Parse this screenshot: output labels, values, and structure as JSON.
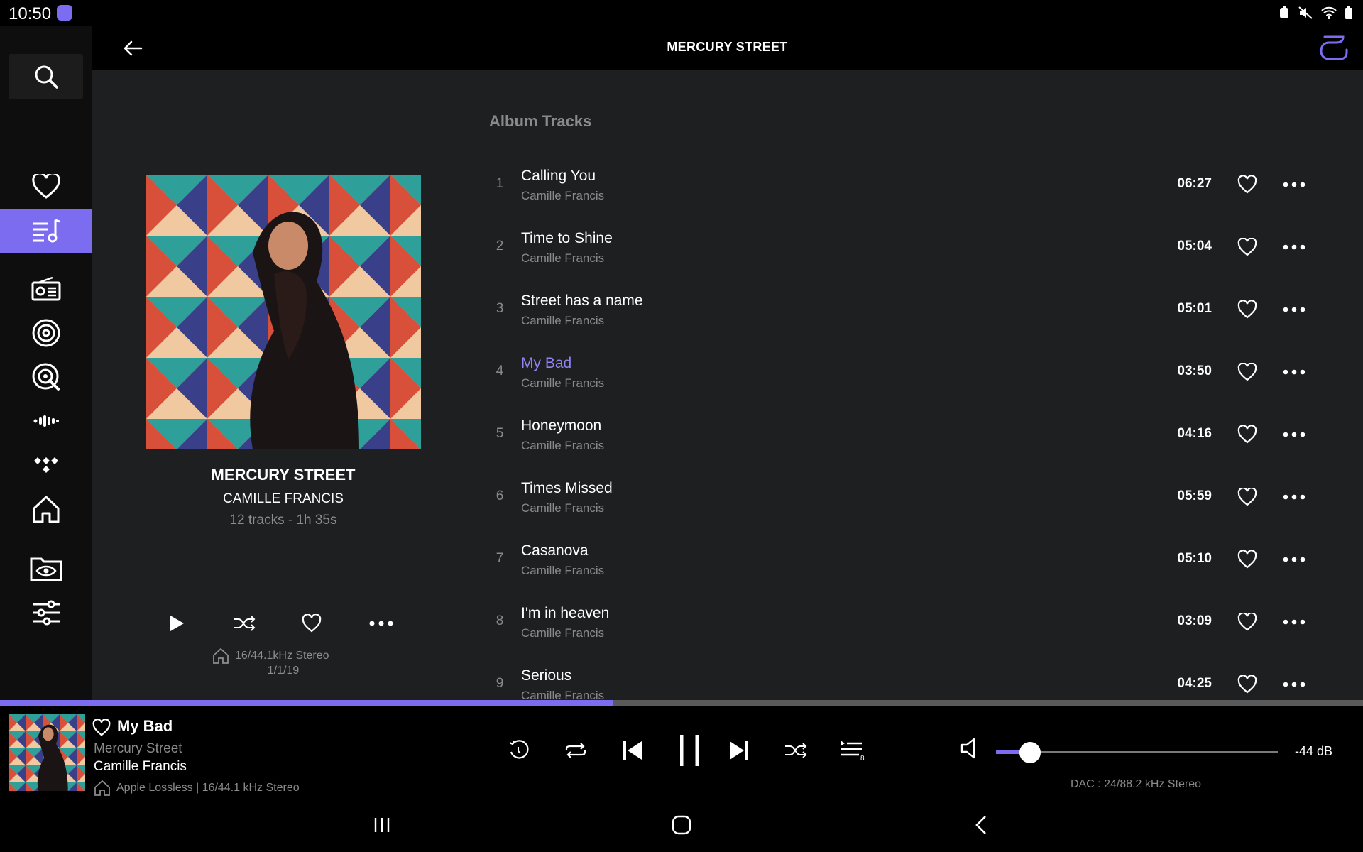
{
  "status": {
    "time": "10:50"
  },
  "header": {
    "title": "MERCURY STREET"
  },
  "sidebar": {
    "items": [
      {
        "name": "search-icon"
      },
      {
        "name": "heart-icon"
      },
      {
        "name": "library-icon",
        "active": true
      },
      {
        "name": "radio-icon"
      },
      {
        "name": "live-radio-icon"
      },
      {
        "name": "qobuz-icon"
      },
      {
        "name": "podcast-icon"
      },
      {
        "name": "tidal-icon"
      },
      {
        "name": "home-icon"
      },
      {
        "name": "folder-eye-icon"
      },
      {
        "name": "settings-sliders-icon"
      }
    ]
  },
  "album": {
    "title": "MERCURY STREET",
    "artist": "CAMILLE FRANCIS",
    "meta": "12 tracks - 1h 35s",
    "format": "16/44.1kHz Stereo",
    "date": "1/1/19"
  },
  "tracks_heading": "Album Tracks",
  "tracks": [
    {
      "num": "1",
      "title": "Calling You",
      "artist": "Camille Francis",
      "duration": "06:27",
      "playing": false
    },
    {
      "num": "2",
      "title": "Time to Shine",
      "artist": "Camille Francis",
      "duration": "05:04",
      "playing": false
    },
    {
      "num": "3",
      "title": "Street has a name",
      "artist": "Camille Francis",
      "duration": "05:01",
      "playing": false
    },
    {
      "num": "4",
      "title": "My Bad",
      "artist": "Camille Francis",
      "duration": "03:50",
      "playing": true
    },
    {
      "num": "5",
      "title": "Honeymoon",
      "artist": "Camille Francis",
      "duration": "04:16",
      "playing": false
    },
    {
      "num": "6",
      "title": "Times Missed",
      "artist": "Camille Francis",
      "duration": "05:59",
      "playing": false
    },
    {
      "num": "7",
      "title": "Casanova",
      "artist": "Camille Francis",
      "duration": "05:10",
      "playing": false
    },
    {
      "num": "8",
      "title": "I'm in heaven",
      "artist": "Camille Francis",
      "duration": "03:09",
      "playing": false
    },
    {
      "num": "9",
      "title": "Serious",
      "artist": "Camille Francis",
      "duration": "04:25",
      "playing": false
    }
  ],
  "now_playing": {
    "title": "My Bad",
    "album": "Mercury Street",
    "artist": "Camille Francis",
    "format": "Apple Lossless | 16/44.1 kHz Stereo",
    "progress_percent": 45,
    "queue_count": "8",
    "volume_percent": 12,
    "volume_db": "-44 dB",
    "dac": "DAC : 24/88.2 kHz Stereo"
  },
  "colors": {
    "accent": "#7b6cf0",
    "playing_text": "#8f84f2",
    "background": "#1e1f21"
  }
}
